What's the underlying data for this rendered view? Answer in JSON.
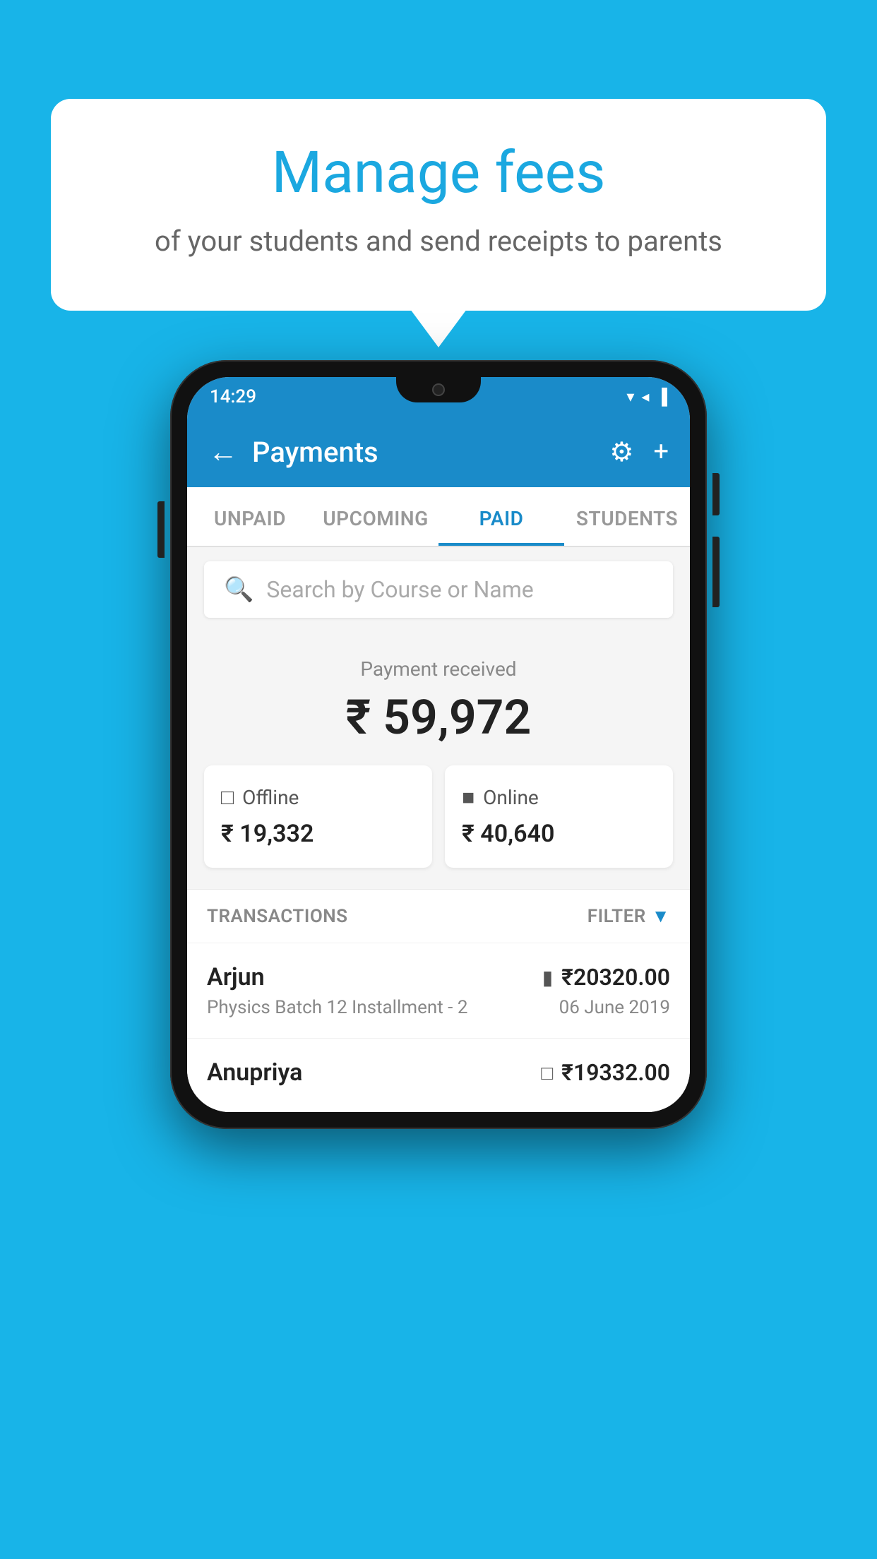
{
  "background_color": "#18b4e8",
  "speech_bubble": {
    "title": "Manage fees",
    "subtitle": "of your students and send receipts to parents"
  },
  "status_bar": {
    "time": "14:29",
    "icons": "▼ ◀ ▐"
  },
  "app_bar": {
    "title": "Payments",
    "back_icon": "←",
    "settings_icon": "⚙",
    "add_icon": "+"
  },
  "tabs": [
    {
      "label": "UNPAID",
      "active": false
    },
    {
      "label": "UPCOMING",
      "active": false
    },
    {
      "label": "PAID",
      "active": true
    },
    {
      "label": "STUDENTS",
      "active": false
    }
  ],
  "search": {
    "placeholder": "Search by Course or Name"
  },
  "payment_summary": {
    "label": "Payment received",
    "amount": "₹ 59,972",
    "offline": {
      "type": "Offline",
      "amount": "₹ 19,332"
    },
    "online": {
      "type": "Online",
      "amount": "₹ 40,640"
    }
  },
  "transactions": {
    "label": "TRANSACTIONS",
    "filter_label": "FILTER",
    "items": [
      {
        "name": "Arjun",
        "detail": "Physics Batch 12 Installment - 2",
        "amount": "₹20320.00",
        "date": "06 June 2019",
        "payment_type": "card"
      },
      {
        "name": "Anupriya",
        "detail": "",
        "amount": "₹19332.00",
        "date": "",
        "payment_type": "offline"
      }
    ]
  }
}
